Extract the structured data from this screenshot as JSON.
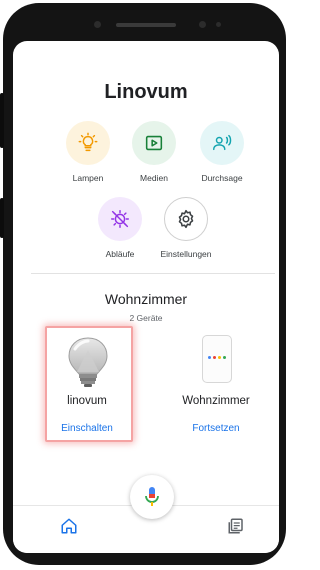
{
  "home": {
    "title": "Linovum"
  },
  "actions": [
    {
      "label": "Lampen",
      "icon": "lightbulb-icon",
      "bg": "#fdf3dd",
      "color": "#f29900"
    },
    {
      "label": "Medien",
      "icon": "media-play-icon",
      "bg": "#e6f4ea",
      "color": "#188038"
    },
    {
      "label": "Durchsage",
      "icon": "broadcast-icon",
      "bg": "#e4f6f7",
      "color": "#12a4af"
    },
    {
      "label": "Abläufe",
      "icon": "routines-icon",
      "bg": "#f3e8fd",
      "color": "#9334e6"
    },
    {
      "label": "Einstellungen",
      "icon": "gear-icon",
      "bg": "#ffffff",
      "color": "#3c4043"
    }
  ],
  "room": {
    "name": "Wohnzimmer",
    "device_count": "2 Geräte"
  },
  "devices": [
    {
      "name": "linovum",
      "action": "Einschalten",
      "icon": "smart-bulb-icon"
    },
    {
      "name": "Wohnzimmer",
      "action": "Fortsetzen",
      "icon": "smart-speaker-icon"
    }
  ],
  "bottom_nav": [
    {
      "icon": "home-icon",
      "active": true
    },
    {
      "icon": "feed-icon",
      "active": false
    }
  ],
  "colors": {
    "accent": "#1a73e8",
    "highlight": "#f5a3a3"
  }
}
